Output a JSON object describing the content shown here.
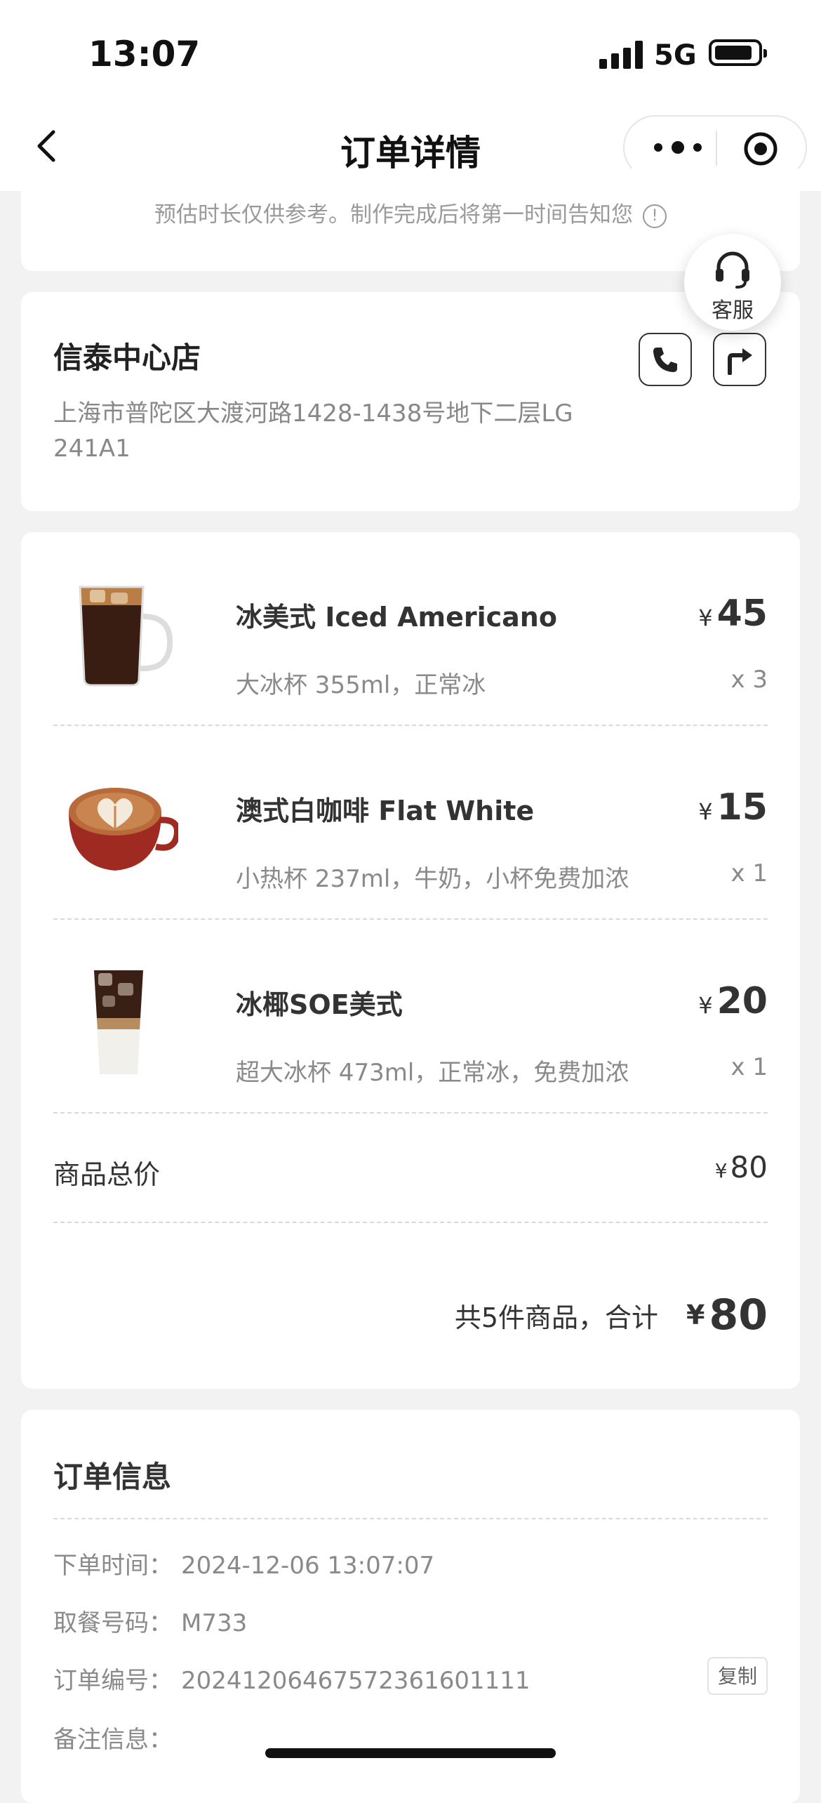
{
  "status_bar": {
    "time": "13:07",
    "network": "5G"
  },
  "nav": {
    "title": "订单详情"
  },
  "pickup_hint": {
    "text": "预估时长仅供参考。制作完成后将第一时间告知您",
    "icon": "info-icon"
  },
  "customer_service": {
    "label": "客服",
    "icon": "headset-icon"
  },
  "store": {
    "name": "信泰中心店",
    "address": "上海市普陀区大渡河路1428-1438号地下二层LG 241A1",
    "phone_icon": "phone-icon",
    "navigate_icon": "directions-icon"
  },
  "items": [
    {
      "name": "冰美式 Iced Americano",
      "spec": "大冰杯 355ml，正常冰",
      "currency": "¥",
      "price": "45",
      "qty": "x 3",
      "image": "iced-americano-glass"
    },
    {
      "name": "澳式白咖啡 Flat White",
      "spec": "小热杯 237ml，牛奶，小杯免费加浓",
      "currency": "¥",
      "price": "15",
      "qty": "x 1",
      "image": "flat-white-cup"
    },
    {
      "name": "冰椰SOE美式",
      "spec": "超大冰杯 473ml，正常冰，免费加浓",
      "currency": "¥",
      "price": "20",
      "qty": "x 1",
      "image": "iced-coconut-americano-cup"
    }
  ],
  "subtotal": {
    "label": "商品总价",
    "currency": "¥",
    "value": "80"
  },
  "total": {
    "text": "共5件商品，合计",
    "currency": "¥",
    "value": "80"
  },
  "order_info": {
    "title": "订单信息",
    "rows": [
      {
        "label": "下单时间：",
        "value": "2024-12-06 13:07:07"
      },
      {
        "label": "取餐号码：",
        "value": "M733"
      },
      {
        "label": "订单编号：",
        "value": "20241206467572361601111"
      },
      {
        "label": "备注信息：",
        "value": ""
      }
    ],
    "copy_label": "复制"
  },
  "colors": {
    "page_bg": "#f2f2f2",
    "card_bg": "#ffffff",
    "text_primary": "#333333",
    "text_secondary": "#8a8a8a"
  }
}
